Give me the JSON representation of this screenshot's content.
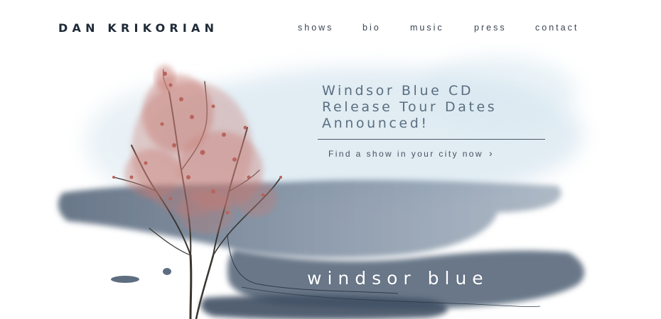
{
  "header": {
    "brand": "DAN KRIKORIAN",
    "nav": [
      "shows",
      "bio",
      "music",
      "press",
      "contact"
    ]
  },
  "promo": {
    "headline_lines": [
      "Windsor Blue CD",
      "Release Tour Dates",
      "Announced!"
    ],
    "cta": "Find a show in your city now",
    "cta_icon": "chevron-right-icon",
    "album_title": "windsor blue"
  },
  "colors": {
    "brand": "#1f2a38",
    "text": "#5b6f80",
    "wash": "#5c6f86",
    "blossom": "#c77a72"
  }
}
